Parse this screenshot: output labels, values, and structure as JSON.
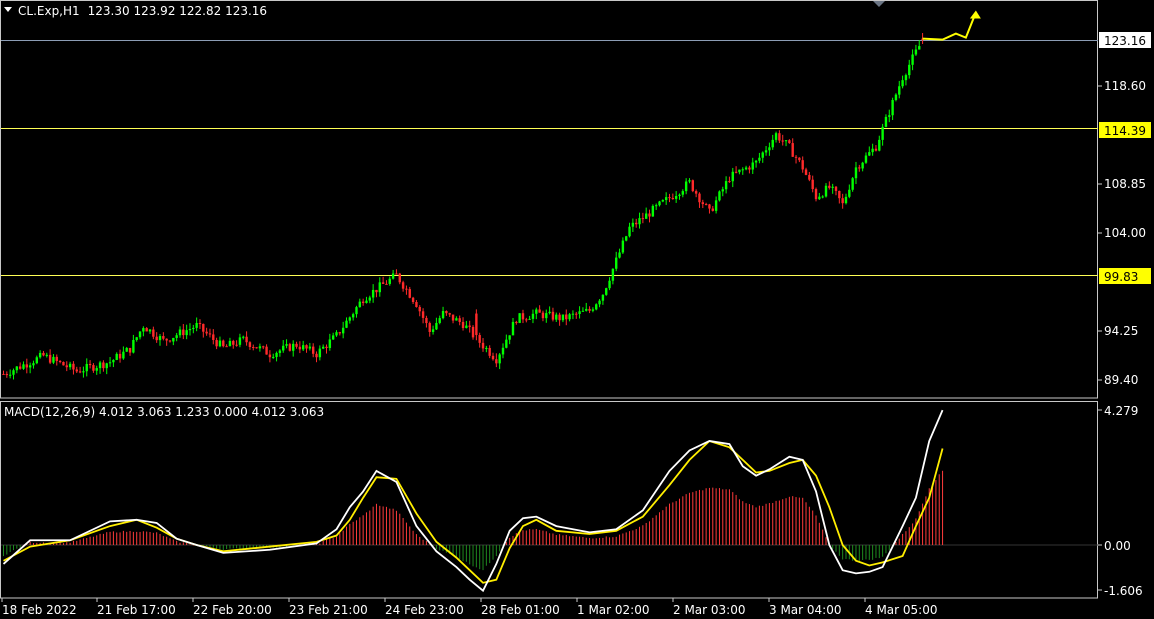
{
  "header": {
    "symbol": "CL.Exp,H1",
    "ohlc": "123.30 123.92 122.82 123.16"
  },
  "macd_header": "MACD(12,26,9) 4.012 3.063 1.233 0.000 4.012 3.063",
  "colors": {
    "background": "#000000",
    "bull": "#00ff00",
    "bear": "#ff2a2a",
    "level_line": "#ffff55",
    "price_line": "#8c9db5",
    "macd_line": "#ffffff",
    "signal_line": "#ffee00",
    "hist_pos": "#ff3b3b",
    "hist_neg": "#1f8a1f",
    "arrow": "#ffff00"
  },
  "price_axis": {
    "ticks": [
      "118.60",
      "108.85",
      "104.00",
      "94.25",
      "89.40"
    ]
  },
  "level_labels": {
    "current": "123.16",
    "resistance": "114.39",
    "support": "99.83"
  },
  "macd_axis": {
    "ticks": [
      "4.279",
      "0.00",
      "-1.606"
    ]
  },
  "time_axis": {
    "labels": [
      "18 Feb 2022",
      "21 Feb 17:00",
      "22 Feb 20:00",
      "23 Feb 21:00",
      "24 Feb 23:00",
      "28 Feb 01:00",
      "1 Mar 02:00",
      "2 Mar 03:00",
      "3 Mar 04:00",
      "4 Mar 05:00"
    ]
  },
  "chart_data": [
    {
      "type": "candlestick",
      "symbol": "CL.Exp",
      "timeframe": "H1",
      "ylim": [
        88.6,
        126.0
      ],
      "levels": [
        123.16,
        114.39,
        99.83
      ],
      "series": [
        {
          "name": "CL.Exp",
          "x": [
            0,
            12,
            22,
            32,
            38,
            42,
            48,
            58,
            66,
            72,
            80,
            88,
            94,
            100,
            108,
            118,
            124,
            128,
            132,
            138,
            142,
            148,
            154,
            160,
            168,
            176,
            180,
            188,
            196,
            206,
            212,
            218,
            226,
            232,
            236,
            240,
            244,
            248,
            250,
            252,
            256,
            262,
            270,
            276
          ],
          "close": [
            90.0,
            91.8,
            90.3,
            91.2,
            92.5,
            94.8,
            93.3,
            94.8,
            92.6,
            93.4,
            92.0,
            92.9,
            92.0,
            93.8,
            97.5,
            99.8,
            97.0,
            94.2,
            96.0,
            95.0,
            93.5,
            91.5,
            95.5,
            96.0,
            95.5,
            96.3,
            98.0,
            104.5,
            106.5,
            109.0,
            106.0,
            109.5,
            111.0,
            113.8,
            112.5,
            110.5,
            107.6,
            108.5,
            107.8,
            106.8,
            110.5,
            112.6,
            119.5,
            123.16
          ]
        }
      ],
      "projection": [
        {
          "x": 276,
          "y": 123.3
        },
        {
          "x": 282,
          "y": 123.2
        },
        {
          "x": 286,
          "y": 123.8
        },
        {
          "x": 289,
          "y": 123.4
        },
        {
          "x": 292,
          "y": 125.9
        }
      ]
    },
    {
      "type": "line",
      "title": "MACD(12,26,9)",
      "ylim": [
        -1.606,
        4.279
      ],
      "series": [
        {
          "name": "MACD",
          "x": [
            0,
            8,
            20,
            32,
            40,
            46,
            52,
            58,
            66,
            80,
            94,
            100,
            104,
            108,
            112,
            118,
            124,
            130,
            136,
            140,
            144,
            148,
            152,
            156,
            160,
            166,
            176,
            184,
            192,
            200,
            206,
            212,
            218,
            222,
            226,
            230,
            236,
            240,
            244,
            248,
            252,
            256,
            260,
            264,
            270,
            274,
            278,
            282
          ],
          "y": [
            -0.6,
            0.15,
            0.15,
            0.75,
            0.8,
            0.7,
            0.2,
            0.0,
            -0.25,
            -0.15,
            0.05,
            0.5,
            1.2,
            1.7,
            2.35,
            2.0,
            0.6,
            -0.2,
            -0.7,
            -1.1,
            -1.45,
            -0.6,
            0.45,
            0.85,
            0.9,
            0.6,
            0.4,
            0.5,
            1.1,
            2.35,
            3.0,
            3.3,
            3.2,
            2.5,
            2.2,
            2.4,
            2.8,
            2.7,
            1.7,
            0.0,
            -0.8,
            -0.9,
            -0.85,
            -0.7,
            0.6,
            1.5,
            3.3,
            4.279
          ]
        },
        {
          "name": "Signal",
          "x": [
            0,
            8,
            20,
            32,
            40,
            46,
            52,
            58,
            66,
            80,
            94,
            100,
            104,
            108,
            112,
            118,
            124,
            130,
            136,
            140,
            144,
            148,
            152,
            156,
            160,
            166,
            176,
            184,
            192,
            200,
            206,
            212,
            218,
            222,
            226,
            230,
            236,
            240,
            244,
            248,
            252,
            256,
            260,
            264,
            270,
            274,
            278,
            282
          ],
          "y": [
            -0.5,
            -0.05,
            0.15,
            0.6,
            0.8,
            0.55,
            0.2,
            0.0,
            -0.2,
            -0.05,
            0.1,
            0.3,
            0.8,
            1.5,
            2.15,
            2.1,
            1.0,
            0.1,
            -0.4,
            -0.8,
            -1.2,
            -1.1,
            -0.1,
            0.6,
            0.8,
            0.45,
            0.35,
            0.45,
            0.9,
            1.9,
            2.7,
            3.3,
            3.1,
            2.7,
            2.3,
            2.35,
            2.6,
            2.7,
            2.2,
            1.2,
            0.0,
            -0.5,
            -0.65,
            -0.55,
            -0.35,
            0.6,
            1.5,
            3.063
          ]
        }
      ]
    }
  ]
}
